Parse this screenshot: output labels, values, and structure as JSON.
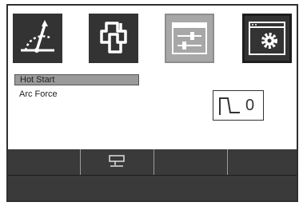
{
  "top_icons": [
    {
      "name": "welding-torch-angle-icon",
      "state": "normal"
    },
    {
      "name": "wire-feed-link-icon",
      "state": "normal"
    },
    {
      "name": "adjust-sliders-icon",
      "state": "selected"
    },
    {
      "name": "settings-window-gear-icon",
      "state": "normal"
    }
  ],
  "menu": {
    "items": [
      {
        "label": "Hot Start",
        "selected": true
      },
      {
        "label": "Arc Force",
        "selected": false
      }
    ]
  },
  "value_display": {
    "icon": "pulse-step-icon",
    "value": "0"
  },
  "softkeys": [
    {
      "icon": ""
    },
    {
      "icon": "panel-stand-icon"
    },
    {
      "icon": ""
    },
    {
      "icon": ""
    }
  ],
  "colors": {
    "bar": "#3a3a3a",
    "tile_dark": "#333333",
    "tile_selected": "#a7a7a7",
    "highlight": "#9a9a9a"
  }
}
